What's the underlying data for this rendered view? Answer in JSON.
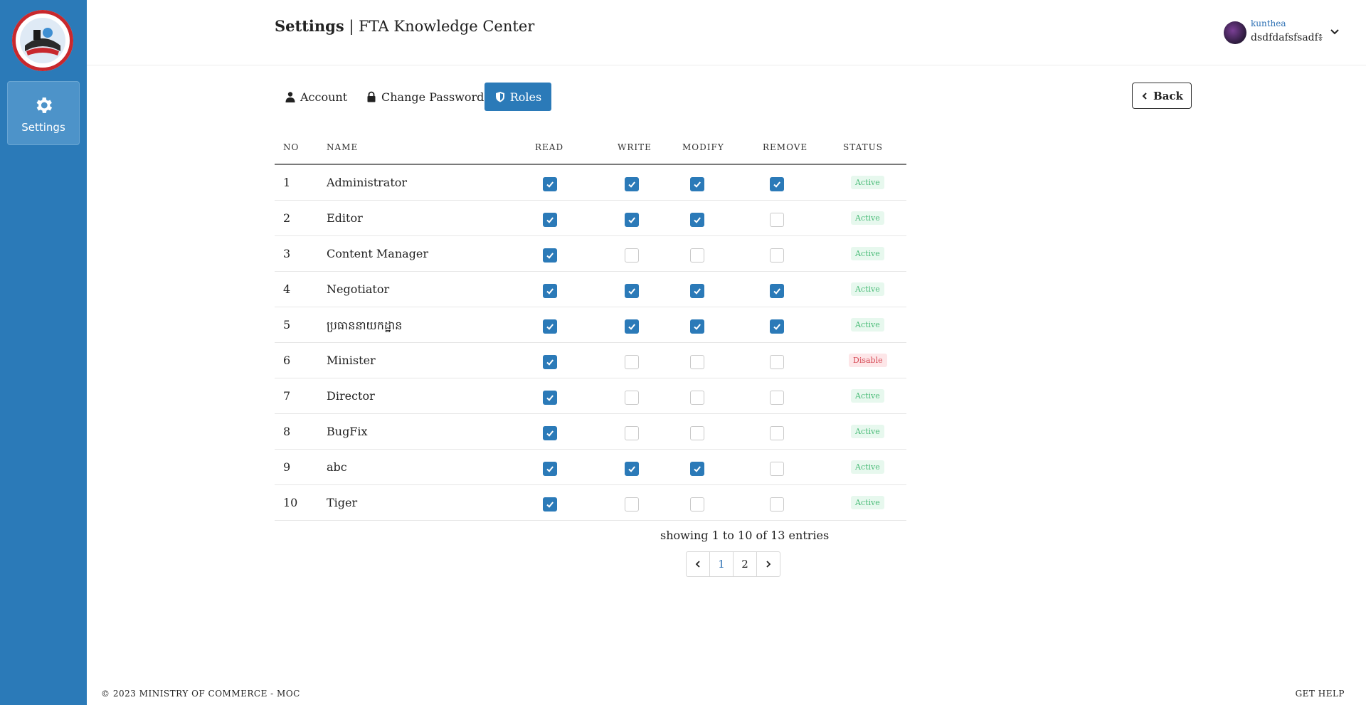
{
  "sidebar": {
    "nav_item_label": "Settings"
  },
  "header": {
    "title_bold": "Settings",
    "title_separator": " | ",
    "title_app": "FTA Knowledge Center",
    "user_name": "kunthea",
    "user_subtitle": "dsdfdafsfsadf៖"
  },
  "tabs": [
    {
      "label": "Account",
      "icon": "user-icon",
      "active": false
    },
    {
      "label": "Change Password",
      "icon": "lock-icon",
      "active": false
    },
    {
      "label": "Roles",
      "icon": "shield-icon",
      "active": true
    }
  ],
  "back_button": {
    "label": "Back"
  },
  "table": {
    "headers": {
      "no": "NO",
      "name": "NAME",
      "read": "READ",
      "write": "WRITE",
      "modify": "MODIFY",
      "remove": "REMOVE",
      "status": "STATUS"
    },
    "rows": [
      {
        "no": "1",
        "name": "Administrator",
        "read": true,
        "write": true,
        "modify": true,
        "remove": true,
        "status": "Active"
      },
      {
        "no": "2",
        "name": "Editor",
        "read": true,
        "write": true,
        "modify": true,
        "remove": false,
        "status": "Active"
      },
      {
        "no": "3",
        "name": "Content Manager",
        "read": true,
        "write": false,
        "modify": false,
        "remove": false,
        "status": "Active"
      },
      {
        "no": "4",
        "name": "Negotiator",
        "read": true,
        "write": true,
        "modify": true,
        "remove": true,
        "status": "Active"
      },
      {
        "no": "5",
        "name": "ប្រធាននាយកដ្ឋាន",
        "read": true,
        "write": true,
        "modify": true,
        "remove": true,
        "status": "Active"
      },
      {
        "no": "6",
        "name": "Minister",
        "read": true,
        "write": false,
        "modify": false,
        "remove": false,
        "status": "Disable"
      },
      {
        "no": "7",
        "name": "Director",
        "read": true,
        "write": false,
        "modify": false,
        "remove": false,
        "status": "Active"
      },
      {
        "no": "8",
        "name": "BugFix",
        "read": true,
        "write": false,
        "modify": false,
        "remove": false,
        "status": "Active"
      },
      {
        "no": "9",
        "name": "abc",
        "read": true,
        "write": true,
        "modify": true,
        "remove": false,
        "status": "Active"
      },
      {
        "no": "10",
        "name": "Tiger",
        "read": true,
        "write": false,
        "modify": false,
        "remove": false,
        "status": "Active"
      }
    ]
  },
  "pagination": {
    "info": "showing 1 to 10 of 13 entries",
    "pages": [
      "1",
      "2"
    ],
    "current_page": "1"
  },
  "footer": {
    "copyright": "© 2023 MINISTRY OF COMMERCE - MOC",
    "help": "GET HELP"
  },
  "colors": {
    "primary": "#2b7ab8",
    "active_badge_bg": "#e7f8ee",
    "active_badge_text": "#4cbc79",
    "disable_badge_bg": "#fde6e8",
    "disable_badge_text": "#d64a55"
  }
}
